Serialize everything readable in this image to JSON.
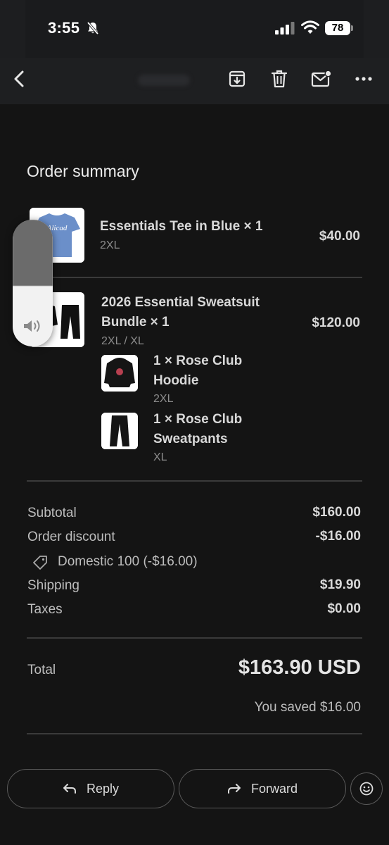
{
  "status_bar": {
    "time": "3:55",
    "battery": "78"
  },
  "toolbar": {
    "icons": [
      "back-arrow-icon",
      "archive-icon",
      "trash-icon",
      "mark-unread-icon",
      "more-icon"
    ]
  },
  "order": {
    "heading": "Order summary",
    "items": [
      {
        "title": "Essentials Tee in Blue × 1",
        "variant": "2XL",
        "price": "$40.00",
        "thumb_text": "Alicad"
      },
      {
        "title_line1": "2026 Essential Sweatsuit",
        "title_line2": "Bundle × 1",
        "variant": "2XL / XL",
        "price": "$120.00",
        "components": [
          {
            "line1": "1 × Rose Club",
            "line2": "Hoodie",
            "variant": "2XL"
          },
          {
            "line1": "1 × Rose Club",
            "line2": "Sweatpants",
            "variant": "XL"
          }
        ]
      }
    ],
    "summary": {
      "subtotal_label": "Subtotal",
      "subtotal_value": "$160.00",
      "discount_label": "Order discount",
      "discount_value": "-$16.00",
      "discount_code": "Domestic 100 (-$16.00)",
      "shipping_label": "Shipping",
      "shipping_value": "$19.90",
      "taxes_label": "Taxes",
      "taxes_value": "$0.00",
      "total_label": "Total",
      "total_value": "$163.90 USD",
      "saved_text": "You saved $16.00"
    }
  },
  "actions": {
    "reply_label": "Reply",
    "forward_label": "Forward"
  },
  "colors": {
    "background": "#141414",
    "toolbar": "#1e1f21",
    "text_primary": "#d8d8d8",
    "text_muted": "#8d8d8d"
  }
}
